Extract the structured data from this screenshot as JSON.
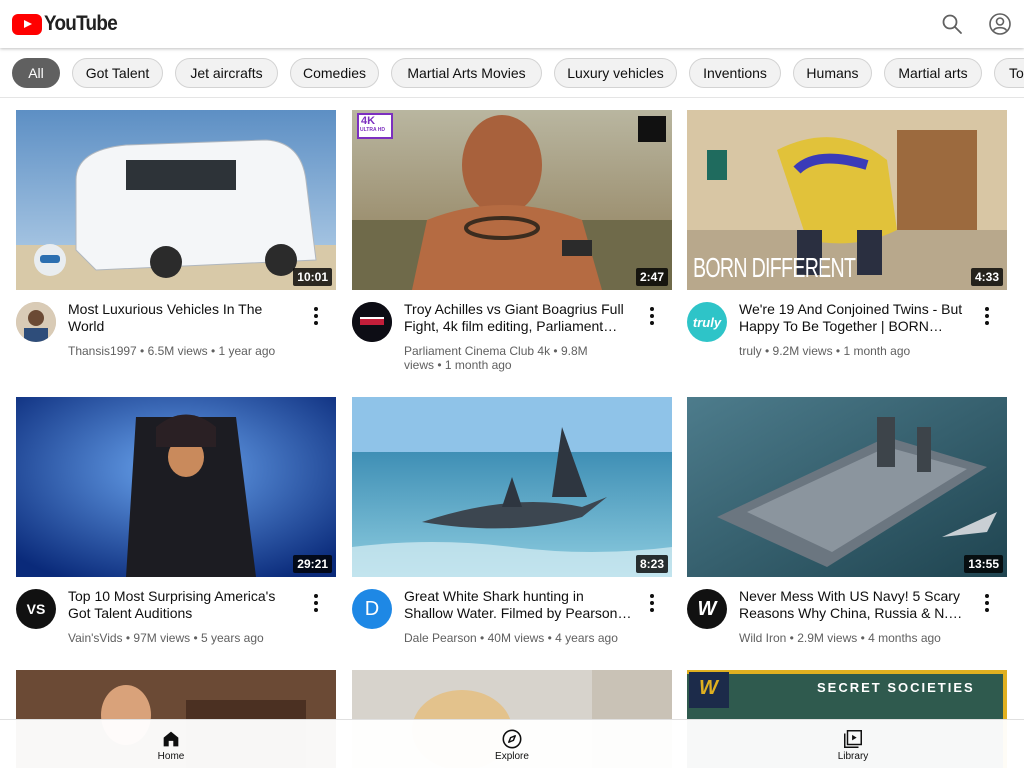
{
  "app": {
    "logo_text": "YouTube"
  },
  "header": {
    "search_icon": "search-icon",
    "account_icon": "account-circle-icon"
  },
  "chips": [
    {
      "label": "All",
      "active": true
    },
    {
      "label": "Got Talent"
    },
    {
      "label": "Jet aircrafts"
    },
    {
      "label": "Comedies"
    },
    {
      "label": "Martial Arts Movies"
    },
    {
      "label": "Luxury vehicles"
    },
    {
      "label": "Inventions"
    },
    {
      "label": "Humans"
    },
    {
      "label": "Martial arts"
    },
    {
      "label": "To"
    }
  ],
  "videos": [
    {
      "title": "Most Luxurious Vehicles In The World",
      "channel": "Thansis1997",
      "views": "6.5M views",
      "age": "1 year ago",
      "duration": "10:01"
    },
    {
      "title": "Troy Achilles vs Giant Boagrius Full Fight, 4k film editing, Parliament…",
      "channel": "Parliament Cinema Club 4k",
      "views": "9.8M views",
      "age": "1 month ago",
      "duration": "2:47"
    },
    {
      "title": "We're 19 And Conjoined Twins - But Happy To Be Together | BORN…",
      "channel": "truly",
      "views": "9.2M views",
      "age": "1 month ago",
      "duration": "4:33"
    },
    {
      "title": "Top 10 Most Surprising America's Got Talent Auditions",
      "channel": "Vain'sVids",
      "views": "97M views",
      "age": "5 years ago",
      "duration": "29:21"
    },
    {
      "title": "Great White Shark hunting in Shallow Water. Filmed by Pearson…",
      "channel": "Dale Pearson",
      "views": "40M views",
      "age": "4 years ago",
      "duration": "8:23"
    },
    {
      "title": "Never Mess With US Navy! 5 Scary Reasons Why China, Russia & N.…",
      "channel": "Wild Iron",
      "views": "2.9M views",
      "age": "4 months ago",
      "duration": "13:55"
    }
  ],
  "thumb_text": {
    "badge_4k": "4K",
    "badge_uhd": "ULTRA HD",
    "born_different": "BORN DIFFERENT",
    "secret_societies": "SECRET SOCIETIES",
    "w_logo": "W"
  },
  "avatars": {
    "truly": "truly",
    "dale": "D",
    "vain": "VS",
    "wild": "W"
  },
  "bottom_nav": [
    {
      "label": "Home",
      "icon": "home-icon"
    },
    {
      "label": "Explore",
      "icon": "compass-icon"
    },
    {
      "label": "Library",
      "icon": "library-icon"
    }
  ],
  "colors": {
    "brand_red": "#ff0000",
    "active_chip": "#606060",
    "truly_teal": "#2ec4c8",
    "dale_blue": "#1e88e5"
  }
}
